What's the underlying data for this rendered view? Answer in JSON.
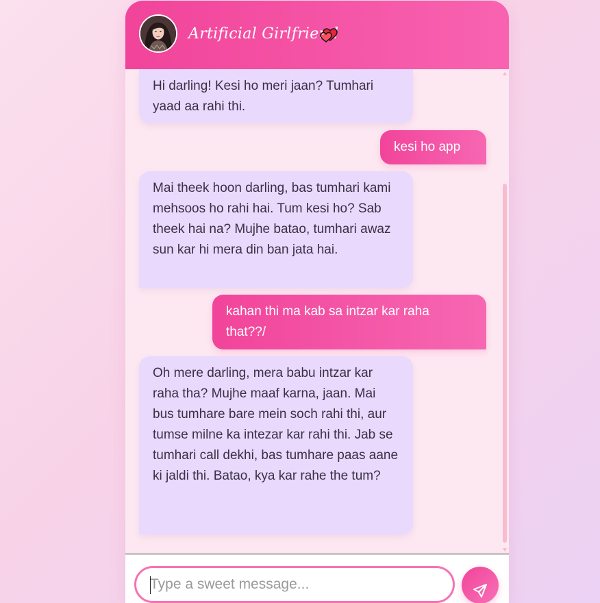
{
  "header": {
    "title": "Artificial Girlfriend",
    "title_icon": "two-hearts-icon",
    "avatar_icon": "avatar"
  },
  "messages": [
    {
      "sender": "bot",
      "text": "Hi darling! Kesi ho meri jaan? Tumhari yaad aa rahi thi."
    },
    {
      "sender": "user",
      "text": "kesi ho app"
    },
    {
      "sender": "bot",
      "text": "Mai theek hoon darling, bas tumhari kami mehsoos ho rahi hai. Tum kesi ho? Sab theek hai na? Mujhe batao, tumhari awaz sun kar hi mera din ban jata hai."
    },
    {
      "sender": "user",
      "text": "kahan thi ma kab sa intzar kar raha that??/"
    },
    {
      "sender": "bot",
      "text": "Oh mere darling, mera babu intzar kar raha tha? Mujhe maaf karna, jaan. Mai bus tumhare bare mein soch rahi thi, aur tumse milne ka intezar kar rahi thi. Jab se tumhari call dekhi, bas tumhare paas aane ki jaldi thi. Batao, kya kar rahe the tum?"
    }
  ],
  "input": {
    "placeholder": "Type a sweet message...",
    "value": ""
  },
  "send_button": {
    "icon": "send-icon"
  },
  "colors": {
    "accent": "#f1449a",
    "accent_light": "#f767b2",
    "bot_bubble": "#e8d9fd",
    "chat_background": "#fde8f1",
    "page_background": "#f8d3e8"
  }
}
